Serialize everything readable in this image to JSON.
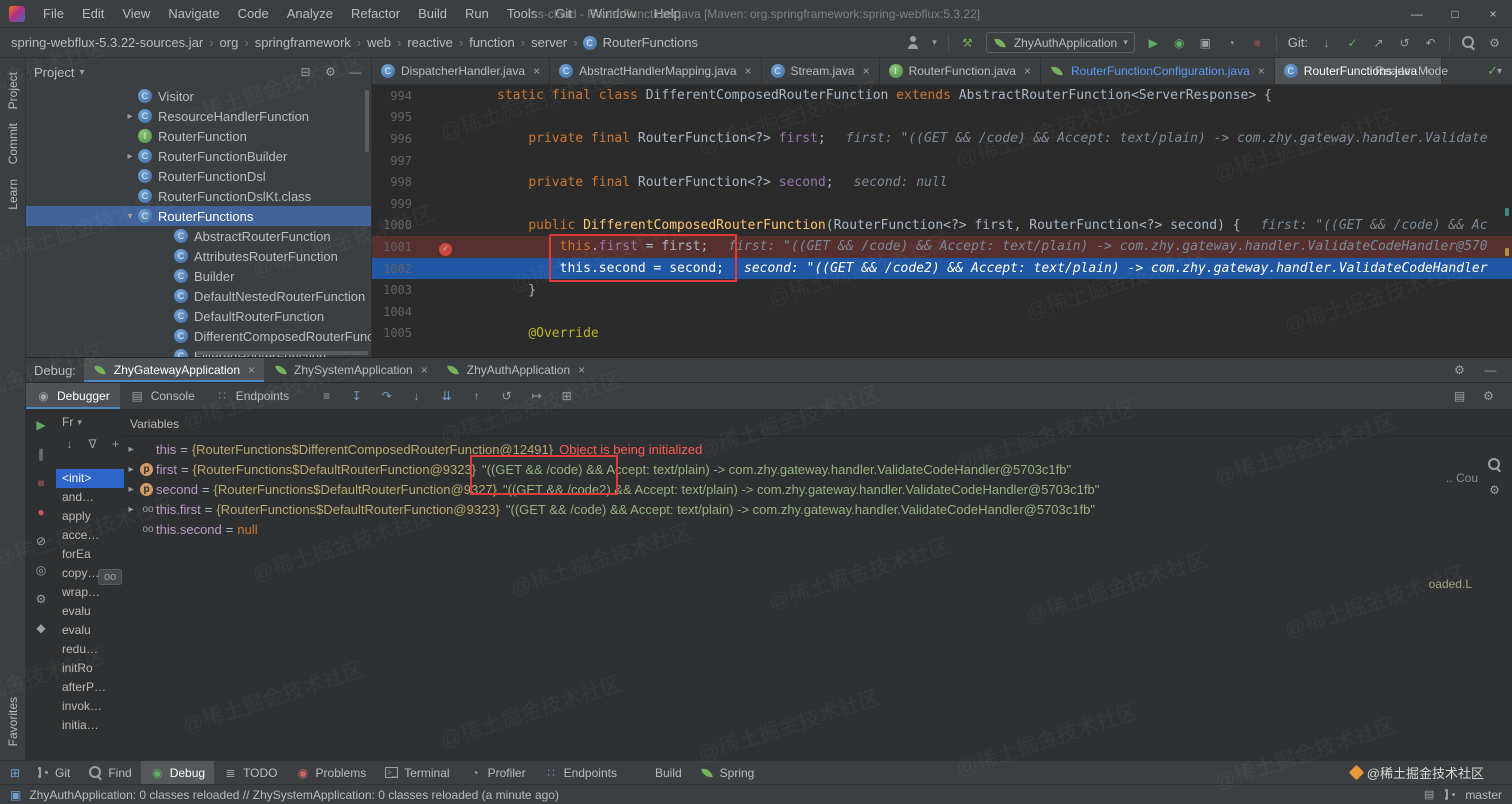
{
  "watermark": {
    "tile": "@稀土掘金技术社区",
    "badge": "@稀土掘金技术社区"
  },
  "fragments": [
    ".. Cou",
    "oaded.L"
  ],
  "title_bar": {
    "title": "ss-cloud - RouterFunctions.java [Maven: org.springframework:spring-webflux:5.3.22]",
    "menus": [
      "File",
      "Edit",
      "View",
      "Navigate",
      "Code",
      "Analyze",
      "Refactor",
      "Build",
      "Run",
      "Tools",
      "Git",
      "Window",
      "Help"
    ]
  },
  "toolbar": {
    "breadcrumbs": [
      "spring-webflux-5.3.22-sources.jar",
      "org",
      "springframework",
      "web",
      "reactive",
      "function",
      "server",
      "RouterFunctions"
    ],
    "git_label": "Git:",
    "run_config": "ZhyAuthApplication",
    "left_icons": [
      "user-icon",
      "build-hammer-icon"
    ],
    "run_icons": [
      "run-icon",
      "debug-icon",
      "coverage-icon",
      "profiler-icon",
      "stop-icon"
    ],
    "git_icons": [
      "update-icon",
      "commit-icon",
      "push-icon",
      "history-icon",
      "rollback-icon"
    ],
    "far_icons": [
      "search-icon",
      "settings-icon"
    ]
  },
  "left_stripe": {
    "top": [
      "Project",
      "Commit",
      "Learn"
    ],
    "bottom": [
      "Favorites"
    ]
  },
  "project": {
    "title": "Project",
    "header_icons": [
      "collapse-all-icon",
      "settings-icon",
      "hide-icon"
    ],
    "tree": [
      {
        "label": "Visitor",
        "depth": 0,
        "icon": "class",
        "arrow": ""
      },
      {
        "label": "ResourceHandlerFunction",
        "depth": 0,
        "icon": "class",
        "arrow": "▸"
      },
      {
        "label": "RouterFunction",
        "depth": 0,
        "icon": "interface",
        "arrow": ""
      },
      {
        "label": "RouterFunctionBuilder",
        "depth": 0,
        "icon": "class",
        "arrow": "▸"
      },
      {
        "label": "RouterFunctionDsl",
        "depth": 0,
        "icon": "class",
        "arrow": ""
      },
      {
        "label": "RouterFunctionDslKt.class",
        "depth": 0,
        "icon": "class",
        "arrow": ""
      },
      {
        "label": "RouterFunctions",
        "depth": 0,
        "icon": "class",
        "arrow": "▾",
        "selected": true
      },
      {
        "label": "AbstractRouterFunction",
        "depth": 1,
        "icon": "class",
        "arrow": ""
      },
      {
        "label": "AttributesRouterFunction",
        "depth": 1,
        "icon": "class",
        "arrow": ""
      },
      {
        "label": "Builder",
        "depth": 1,
        "icon": "class",
        "arrow": ""
      },
      {
        "label": "DefaultNestedRouterFunction",
        "depth": 1,
        "icon": "class",
        "arrow": ""
      },
      {
        "label": "DefaultRouterFunction",
        "depth": 1,
        "icon": "class",
        "arrow": ""
      },
      {
        "label": "DifferentComposedRouterFunct",
        "depth": 1,
        "icon": "class",
        "arrow": ""
      },
      {
        "label": "FilteredRouterFunction",
        "depth": 1,
        "icon": "class",
        "arrow": ""
      }
    ]
  },
  "tabs": [
    {
      "label": "DispatcherHandler.java",
      "icon": "class"
    },
    {
      "label": "AbstractHandlerMapping.java",
      "icon": "class"
    },
    {
      "label": "Stream.java",
      "icon": "class"
    },
    {
      "label": "RouterFunction.java",
      "icon": "interface"
    },
    {
      "label": "RouterFunctionConfiguration.java",
      "icon": "spring",
      "accent": true
    },
    {
      "label": "RouterFunctions.java",
      "icon": "class",
      "active": true
    }
  ],
  "editor": {
    "reader_mode": "Reader Mode",
    "lines": [
      {
        "num": "994",
        "tokens": [
          [
            "kw",
            "static final class "
          ],
          [
            "plain",
            "DifferentComposedRouterFunction "
          ],
          [
            "kw",
            "extends "
          ],
          [
            "plain",
            "AbstractRouterFunction<ServerResponse> {"
          ]
        ],
        "hint": ""
      },
      {
        "num": "995",
        "tokens": [],
        "hint": ""
      },
      {
        "num": "996",
        "tokens": [
          [
            "plain",
            "    "
          ],
          [
            "kw",
            "private final "
          ],
          [
            "plain",
            "RouterFunction<?> "
          ],
          [
            "field",
            "first"
          ],
          [
            "plain",
            ";"
          ]
        ],
        "hint": "first: \"((GET && /code) && Accept: text/plain) -> com.zhy.gateway.handler.Validate"
      },
      {
        "num": "997",
        "tokens": [],
        "hint": ""
      },
      {
        "num": "998",
        "tokens": [
          [
            "plain",
            "    "
          ],
          [
            "kw",
            "private final "
          ],
          [
            "plain",
            "RouterFunction<?> "
          ],
          [
            "field",
            "second"
          ],
          [
            "plain",
            ";"
          ]
        ],
        "hint": "second: null"
      },
      {
        "num": "999",
        "tokens": [],
        "hint": ""
      },
      {
        "num": "1000",
        "tokens": [
          [
            "plain",
            "    "
          ],
          [
            "kw",
            "public "
          ],
          [
            "method",
            "DifferentComposedRouterFunction"
          ],
          [
            "plain",
            "(RouterFunction<?> first, RouterFunction<?> second) {"
          ]
        ],
        "hint": "first: \"((GET && /code) && Ac"
      },
      {
        "num": "1001",
        "state": "bp",
        "tokens": [
          [
            "plain",
            "        "
          ],
          [
            "kw",
            "this"
          ],
          [
            "plain",
            "."
          ],
          [
            "field",
            "first"
          ],
          [
            "plain",
            " = first;"
          ]
        ],
        "hint": "first: \"((GET && /code) && Accept: text/plain) -> com.zhy.gateway.handler.ValidateCodeHandler@570"
      },
      {
        "num": "1002",
        "state": "exec",
        "tokens": [
          [
            "plain",
            "        "
          ],
          [
            "kw",
            "this"
          ],
          [
            "plain",
            "."
          ],
          [
            "field",
            "second"
          ],
          [
            "plain",
            " = second;"
          ]
        ],
        "hint": "second: \"((GET && /code2) && Accept: text/plain) -> com.zhy.gateway.handler.ValidateCodeHandler"
      },
      {
        "num": "1003",
        "tokens": [
          [
            "plain",
            "    }"
          ]
        ],
        "hint": ""
      },
      {
        "num": "1004",
        "tokens": [],
        "hint": ""
      },
      {
        "num": "1005",
        "tokens": [
          [
            "plain",
            "    "
          ],
          [
            "ann",
            "@Override"
          ]
        ],
        "hint": ""
      }
    ]
  },
  "debug": {
    "label": "Debug:",
    "sessions": [
      {
        "label": "ZhyGatewayApplication",
        "active": true
      },
      {
        "label": "ZhySystemApplication"
      },
      {
        "label": "ZhyAuthApplication"
      }
    ],
    "header_icons": [
      "settings-icon",
      "hide-icon"
    ],
    "tool_tabs": [
      {
        "label": "Debugger",
        "icon": "debugger-icon",
        "active": true
      },
      {
        "label": "Console",
        "icon": "console-icon"
      },
      {
        "label": "Endpoints",
        "icon": "endpoints-icon"
      }
    ],
    "step_icons": [
      "layout-icon",
      "show-execution-point-icon",
      "step-over-icon",
      "step-into-icon",
      "force-step-into-icon",
      "step-out-icon",
      "drop-frame-icon",
      "run-to-cursor-icon",
      "evaluate-expression-icon"
    ],
    "right_icons": [
      "restore-layout-icon",
      "settings-icon"
    ],
    "strip_icons": [
      "resume-icon",
      "pause-icon",
      "stop-icon",
      "view-breakpoints-icon",
      "mute-breakpoints-icon",
      "thread-dump-icon",
      "debug-settings-icon",
      "pin-icon"
    ],
    "frames_header": "Fr",
    "frame_tool_icons": [
      "sort-icon",
      "filter-icon",
      "add-watch-icon"
    ],
    "frames": [
      "<init>",
      "and…",
      "apply",
      "acce…",
      "forEa",
      "copy…",
      "wrap…",
      "evalu",
      "evalu",
      "redu…",
      "initRo",
      "afterP…",
      "invok…",
      "initia…"
    ],
    "watch_chip": "oo",
    "variables_header": "Variables",
    "variables": [
      {
        "expander": true,
        "badge": "",
        "name": "this",
        "ref": "{RouterFunctions$DifferentComposedRouterFunction@12491}",
        "value": "Object is being initialized",
        "vstyle": "error"
      },
      {
        "expander": true,
        "badge": "param",
        "name": "first",
        "ref": "{RouterFunctions$DefaultRouterFunction@9323}",
        "value": "\"((GET && /code) && Accept: text/plain) -> com.zhy.gateway.handler.ValidateCodeHandler@5703c1fb\"",
        "vstyle": "string"
      },
      {
        "expander": true,
        "badge": "param",
        "name": "second",
        "ref": "{RouterFunctions$DefaultRouterFunction@9327}",
        "value": "\"((GET && /code2) && Accept: text/plain) -> com.zhy.gateway.handler.ValidateCodeHandler@5703c1fb\"",
        "vstyle": "string"
      },
      {
        "expander": true,
        "badge": "watch",
        "name": "this.first",
        "ref": "{RouterFunctions$DefaultRouterFunction@9323}",
        "value": "\"((GET && /code) && Accept: text/plain) -> com.zhy.gateway.handler.ValidateCodeHandler@5703c1fb\"",
        "vstyle": "string"
      },
      {
        "expander": false,
        "badge": "watch",
        "name": "this.second",
        "ref": "",
        "value": "null",
        "vstyle": "keyword"
      }
    ]
  },
  "status_bar": {
    "tools": [
      {
        "label": "Git",
        "icon": "git-icon"
      },
      {
        "label": "Find",
        "icon": "search-icon"
      },
      {
        "label": "Debug",
        "icon": "debug-icon",
        "active": true
      },
      {
        "label": "TODO",
        "icon": "todo-icon"
      },
      {
        "label": "Problems",
        "icon": "problems-icon"
      },
      {
        "label": "Terminal",
        "icon": "terminal-icon"
      },
      {
        "label": "Profiler",
        "icon": "profiler-icon"
      },
      {
        "label": "Endpoints",
        "icon": "endpoints-icon"
      },
      {
        "label": "Build",
        "icon": "build-icon"
      },
      {
        "label": "Spring",
        "icon": "spring-icon"
      }
    ],
    "message": "ZhyAuthApplication: 0 classes reloaded // ZhySystemApplication: 0 classes reloaded (a minute ago)",
    "branch": "master"
  }
}
